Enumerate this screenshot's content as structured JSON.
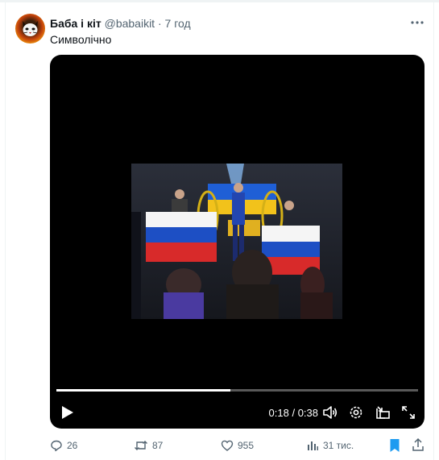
{
  "tweet": {
    "author_name": "Баба і кіт",
    "handle": "@babaikit",
    "separator": "·",
    "time": "7 год",
    "text": "Символічно"
  },
  "video": {
    "current_time": "0:18",
    "duration": "0:38",
    "time_separator": " / ",
    "progress_fraction": 0.48
  },
  "actions": {
    "replies": "26",
    "reposts": "87",
    "likes": "955",
    "views": "31 тис."
  },
  "icons": {
    "more": "more-icon",
    "play": "play-icon",
    "volume": "volume-icon",
    "settings": "settings-icon",
    "pip": "picture-in-picture-icon",
    "fullscreen": "fullscreen-icon",
    "reply": "reply-icon",
    "repost": "repost-icon",
    "like": "like-icon",
    "views": "views-icon",
    "bookmark": "bookmark-icon",
    "share": "share-icon"
  },
  "colors": {
    "accent": "#1d9bf0",
    "text_secondary": "#536471",
    "video_bg": "#000000"
  }
}
